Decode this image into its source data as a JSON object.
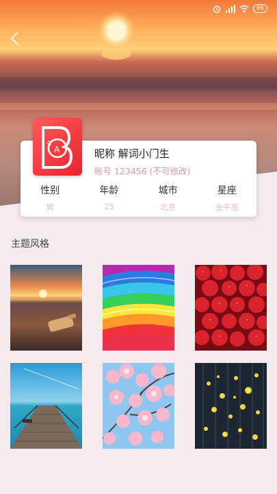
{
  "status_bar": {
    "battery": "96"
  },
  "profile": {
    "nickname": "昵称 解词小门生",
    "account": "账号 123456 (不可修改)",
    "stats": [
      {
        "label": "性别",
        "value": "男"
      },
      {
        "label": "年龄",
        "value": "25"
      },
      {
        "label": "城市",
        "value": "北京"
      },
      {
        "label": "星座",
        "value": "金牛座"
      }
    ]
  },
  "themes": {
    "title": "主题风格"
  },
  "colors": {
    "accent": "#e8232f",
    "page_bg": "#f4ebee"
  }
}
